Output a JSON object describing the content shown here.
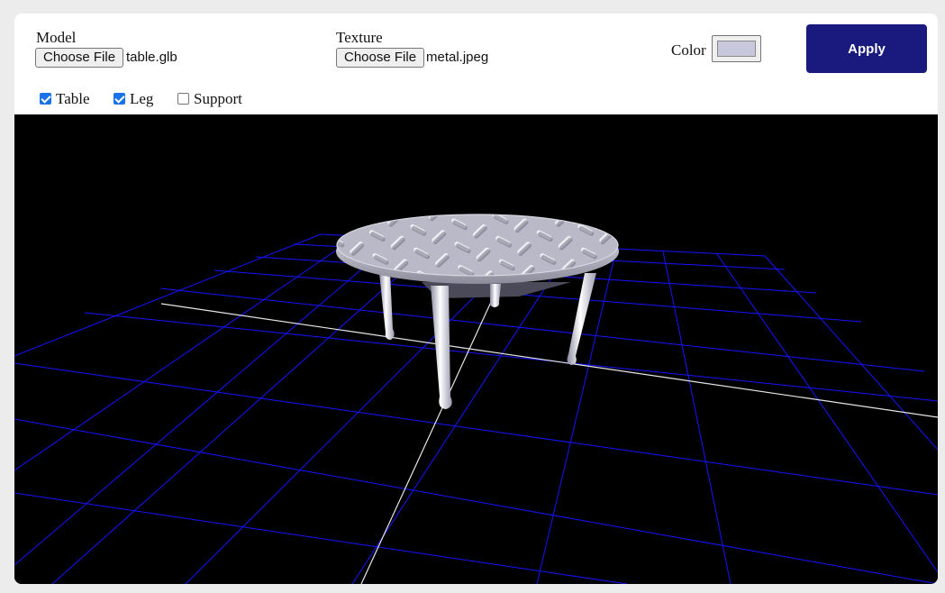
{
  "controls": {
    "model": {
      "label": "Model",
      "button": "Choose File",
      "file": "table.glb"
    },
    "texture": {
      "label": "Texture",
      "button": "Choose File",
      "file": "metal.jpeg"
    },
    "color": {
      "label": "Color",
      "value": "#c8c8dc"
    },
    "apply_label": "Apply"
  },
  "parts": [
    {
      "label": "Table",
      "checked": true
    },
    {
      "label": "Leg",
      "checked": true
    },
    {
      "label": "Support",
      "checked": false
    }
  ],
  "viewport": {
    "background": "#000000",
    "grid_color": "#1414ff",
    "axis_color": "#e0e0e0",
    "model_color": "#c8c8dc"
  }
}
